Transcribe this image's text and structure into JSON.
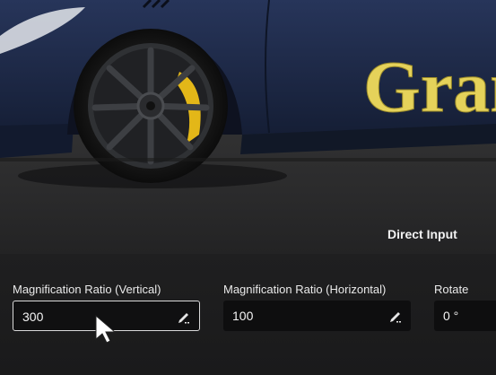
{
  "preview": {
    "livery_text": "Grant",
    "direct_input_label": "Direct Input",
    "colors": {
      "car_body": "#1c2844",
      "livery_fill": "#e5d25a",
      "brake_caliper": "#e3b718"
    }
  },
  "controls": {
    "vertical": {
      "label": "Magnification Ratio (Vertical)",
      "value": "300",
      "icon": "pencil-icon"
    },
    "horizontal": {
      "label": "Magnification Ratio (Horizontal)",
      "value": "100",
      "icon": "pencil-icon"
    },
    "rotate": {
      "label": "Rotate",
      "value": "0 °"
    }
  }
}
